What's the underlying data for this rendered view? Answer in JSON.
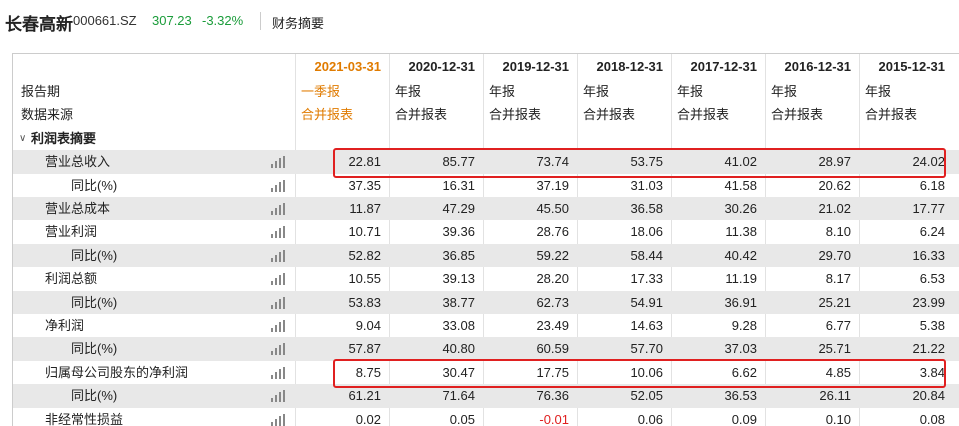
{
  "header": {
    "stock_name": "长春高新",
    "stock_code": "000661.SZ",
    "price": "307.23",
    "change_pct": "-3.32%",
    "page_link": "财务摘要"
  },
  "table": {
    "columns": [
      "2021-03-31",
      "2020-12-31",
      "2019-12-31",
      "2018-12-31",
      "2017-12-31",
      "2016-12-31",
      "2015-12-31"
    ],
    "report_period_label": "报告期",
    "report_periods": [
      "一季报",
      "年报",
      "年报",
      "年报",
      "年报",
      "年报",
      "年报"
    ],
    "data_source_label": "数据来源",
    "data_sources": [
      "合并报表",
      "合并报表",
      "合并报表",
      "合并报表",
      "合并报表",
      "合并报表",
      "合并报表"
    ],
    "section_label": "利润表摘要",
    "rows": [
      {
        "label": "营业总收入",
        "values": [
          "22.81",
          "85.77",
          "73.74",
          "53.75",
          "41.02",
          "28.97",
          "24.02"
        ]
      },
      {
        "label": "同比(%)",
        "values": [
          "37.35",
          "16.31",
          "37.19",
          "31.03",
          "41.58",
          "20.62",
          "6.18"
        ]
      },
      {
        "label": "营业总成本",
        "values": [
          "11.87",
          "47.29",
          "45.50",
          "36.58",
          "30.26",
          "21.02",
          "17.77"
        ]
      },
      {
        "label": "营业利润",
        "values": [
          "10.71",
          "39.36",
          "28.76",
          "18.06",
          "11.38",
          "8.10",
          "6.24"
        ]
      },
      {
        "label": "同比(%)",
        "values": [
          "52.82",
          "36.85",
          "59.22",
          "58.44",
          "40.42",
          "29.70",
          "16.33"
        ]
      },
      {
        "label": "利润总额",
        "values": [
          "10.55",
          "39.13",
          "28.20",
          "17.33",
          "11.19",
          "8.17",
          "6.53"
        ]
      },
      {
        "label": "同比(%)",
        "values": [
          "53.83",
          "38.77",
          "62.73",
          "54.91",
          "36.91",
          "25.21",
          "23.99"
        ]
      },
      {
        "label": "净利润",
        "values": [
          "9.04",
          "33.08",
          "23.49",
          "14.63",
          "9.28",
          "6.77",
          "5.38"
        ]
      },
      {
        "label": "同比(%)",
        "values": [
          "57.87",
          "40.80",
          "60.59",
          "57.70",
          "37.03",
          "25.71",
          "21.22"
        ]
      },
      {
        "label": "归属母公司股东的净利润",
        "values": [
          "8.75",
          "30.47",
          "17.75",
          "10.06",
          "6.62",
          "4.85",
          "3.84"
        ]
      },
      {
        "label": "同比(%)",
        "values": [
          "61.21",
          "71.64",
          "76.36",
          "52.05",
          "36.53",
          "26.11",
          "20.84"
        ]
      },
      {
        "label": "非经常性损益",
        "values": [
          "0.02",
          "0.05",
          "-0.01",
          "0.06",
          "0.09",
          "0.10",
          "0.08"
        ]
      }
    ]
  },
  "colors": {
    "accent": "#e07b00",
    "down": "#1a9c3a",
    "highlight": "#e02020",
    "shaded": "#e8e8e8"
  },
  "icons": {
    "row_chart": "bar-chart-icon",
    "section_toggle": "chevron-down-icon"
  }
}
